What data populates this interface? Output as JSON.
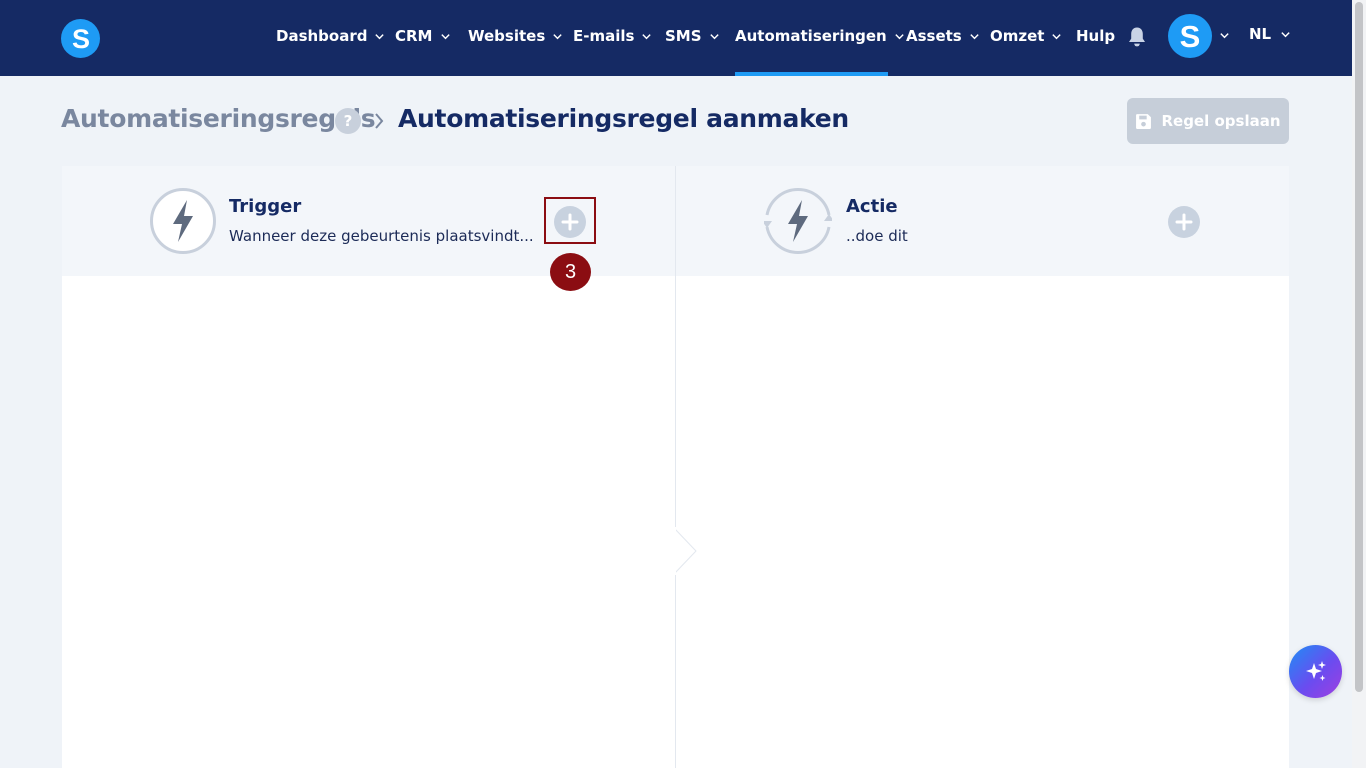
{
  "brand": {
    "logo_letter": "S",
    "accent": "#1e9bf5",
    "nav_bg": "#152a64"
  },
  "nav": {
    "items": [
      {
        "label": "Dashboard",
        "dropdown": true
      },
      {
        "label": "CRM",
        "dropdown": true
      },
      {
        "label": "Websites",
        "dropdown": true
      },
      {
        "label": "E-mails",
        "dropdown": true
      },
      {
        "label": "SMS",
        "dropdown": true
      },
      {
        "label": "Automatiseringen",
        "dropdown": true,
        "active": true
      },
      {
        "label": "Assets",
        "dropdown": true
      },
      {
        "label": "Omzet",
        "dropdown": true
      },
      {
        "label": "Hulp",
        "dropdown": false
      }
    ],
    "notifications_icon": "bell-icon",
    "account": {
      "avatar_letter": "S"
    },
    "language": "NL"
  },
  "breadcrumb": {
    "root": "Automatiseringsregels",
    "help": "?",
    "current": "Automatiseringsregel aanmaken"
  },
  "toolbar": {
    "save_label": "Regel opslaan",
    "save_icon": "floppy-disk-icon"
  },
  "trigger": {
    "title": "Trigger",
    "subtitle": "Wanneer deze gebeurtenis plaatsvindt...",
    "icon": "lightning-icon",
    "add_icon": "plus-icon"
  },
  "action": {
    "title": "Actie",
    "subtitle": "..doe dit",
    "icon": "lightning-cycle-icon",
    "add_icon": "plus-icon"
  },
  "annotation": {
    "step_number": "3",
    "color": "#8b0d12"
  },
  "assistant": {
    "icon": "sparkles-icon"
  }
}
